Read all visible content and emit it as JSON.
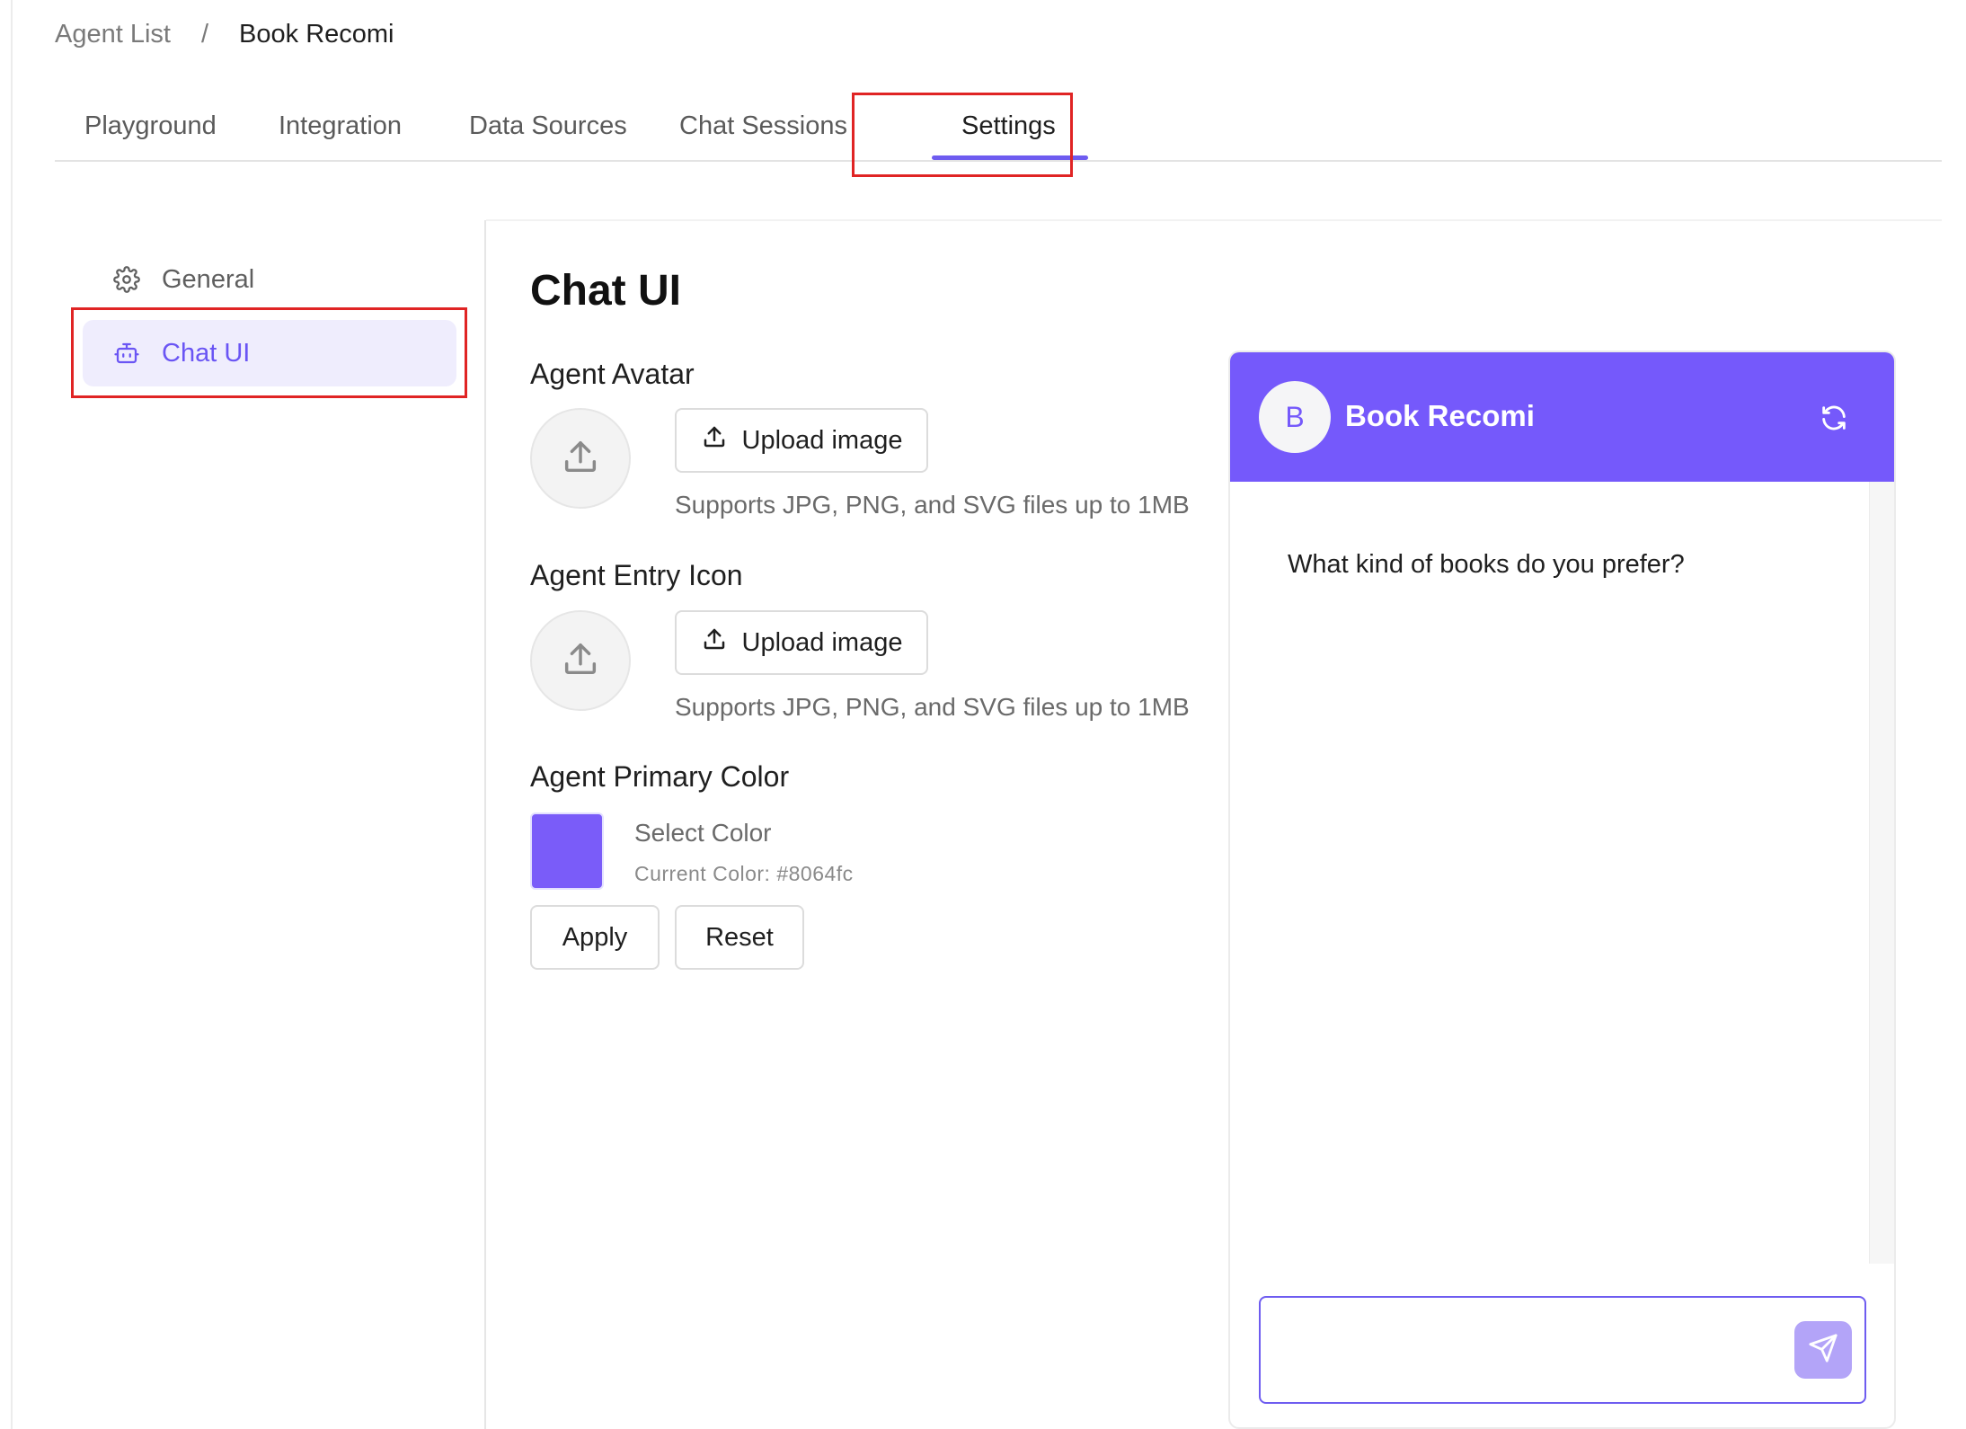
{
  "breadcrumb": {
    "parent": "Agent List",
    "separator": "/",
    "current": "Book Recomi"
  },
  "tabs": [
    {
      "label": "Playground"
    },
    {
      "label": "Integration"
    },
    {
      "label": "Data Sources"
    },
    {
      "label": "Chat Sessions"
    },
    {
      "label": "Settings",
      "active": true
    }
  ],
  "sidebar": {
    "items": [
      {
        "label": "General",
        "icon": "gear-icon"
      },
      {
        "label": "Chat UI",
        "icon": "robot-icon",
        "active": true
      }
    ]
  },
  "main": {
    "title": "Chat UI",
    "avatar": {
      "label": "Agent Avatar",
      "button": "Upload image",
      "hint": "Supports JPG, PNG, and SVG files up to 1MB"
    },
    "entry_icon": {
      "label": "Agent Entry Icon",
      "button": "Upload image",
      "hint": "Supports JPG, PNG, and SVG files up to 1MB"
    },
    "primary_color": {
      "label": "Agent Primary Color",
      "select_label": "Select Color",
      "current": "Current Color: #8064fc",
      "apply": "Apply",
      "reset": "Reset"
    }
  },
  "preview": {
    "avatar_letter": "B",
    "title": "Book Recomi",
    "message": "What kind of books do you prefer?",
    "input_value": ""
  },
  "colors": {
    "accent": "#7559fb",
    "active_tab": "#6e5cf0",
    "highlight": "#e02424"
  }
}
